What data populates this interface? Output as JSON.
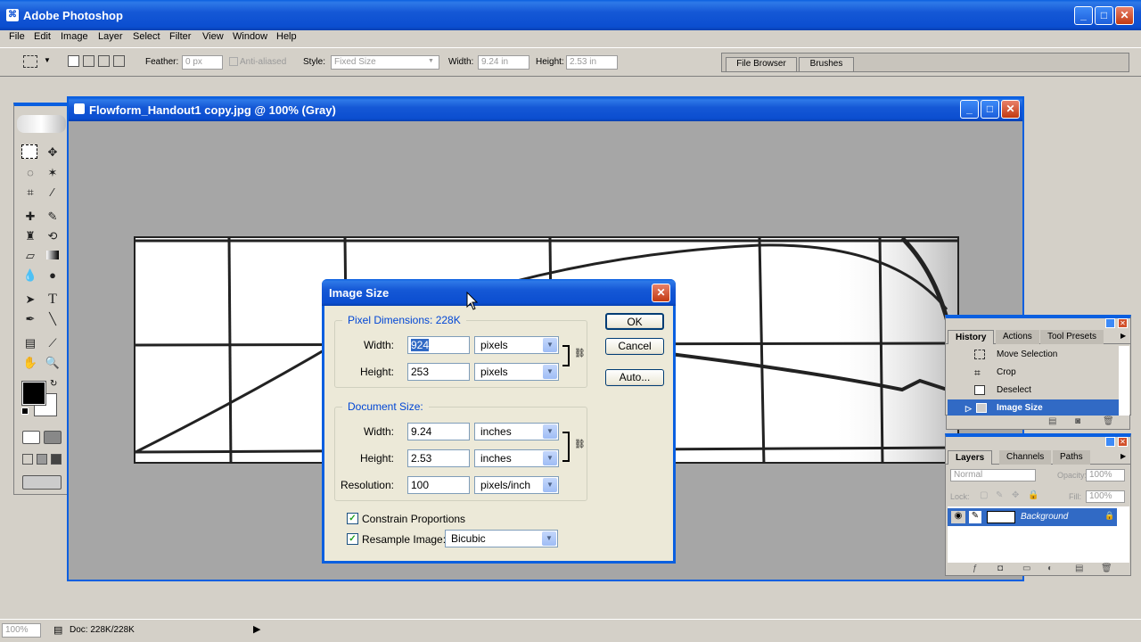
{
  "app": {
    "title": "Adobe Photoshop"
  },
  "menu": [
    "File",
    "Edit",
    "Image",
    "Layer",
    "Select",
    "Filter",
    "View",
    "Window",
    "Help"
  ],
  "options": {
    "feather_label": "Feather:",
    "feather_value": "0 px",
    "antialias_label": "Anti-aliased",
    "style_label": "Style:",
    "style_value": "Fixed Size",
    "width_label": "Width:",
    "width_value": "9.24 in",
    "height_label": "Height:",
    "height_value": "2.53 in"
  },
  "palette_well": {
    "tabs": [
      "File Browser",
      "Brushes"
    ]
  },
  "document": {
    "title": "Flowform_Handout1 copy.jpg @ 100% (Gray)"
  },
  "dialog": {
    "title": "Image Size",
    "pixel_group": "Pixel Dimensions:  228K",
    "doc_group": "Document Size:",
    "width_label": "Width:",
    "height_label": "Height:",
    "resolution_label": "Resolution:",
    "pixel_width": "924",
    "pixel_height": "253",
    "pixel_unit": "pixels",
    "doc_width": "9.24",
    "doc_height": "2.53",
    "doc_unit": "inches",
    "resolution": "100",
    "res_unit": "pixels/inch",
    "constrain_label": "Constrain Proportions",
    "resample_label": "Resample Image:",
    "resample_value": "Bicubic",
    "ok": "OK",
    "cancel": "Cancel",
    "auto": "Auto..."
  },
  "history": {
    "tabs": [
      "History",
      "Actions",
      "Tool Presets"
    ],
    "items": [
      "Move Selection",
      "Crop",
      "Deselect",
      "Image Size"
    ]
  },
  "layers": {
    "tabs": [
      "Layers",
      "Channels",
      "Paths"
    ],
    "blend_mode": "Normal",
    "opacity_label": "Opacity:",
    "opacity_value": "100%",
    "lock_label": "Lock:",
    "fill_label": "Fill:",
    "fill_value": "100%",
    "layer_name": "Background"
  },
  "status": {
    "zoom": "100%",
    "doc_info": "Doc: 228K/228K"
  },
  "colors": {
    "accent": "#316ac5",
    "xp_blue": "#0a5fe0"
  }
}
